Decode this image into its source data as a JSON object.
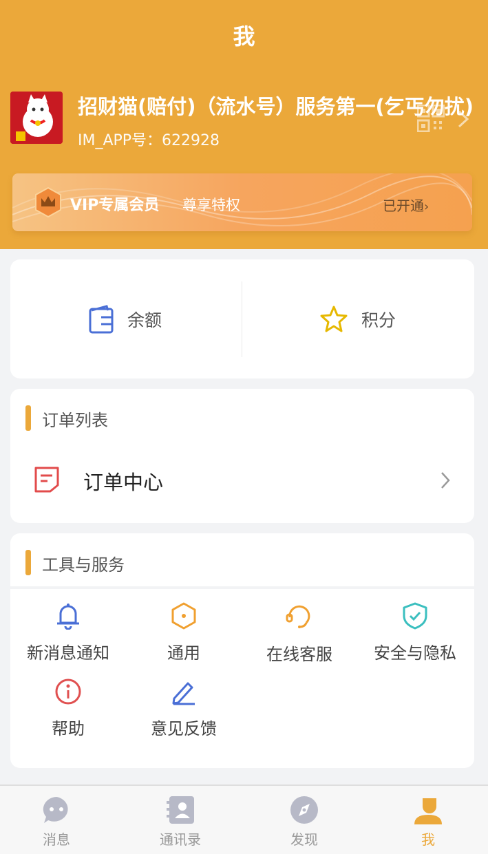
{
  "header": {
    "title": "我",
    "profile": {
      "name": "招财猫(赔付)（流水号）服务第一(乞丐勿扰)",
      "id_text": "IM_APP号：622928"
    },
    "vip": {
      "title": "VIP专属会员",
      "subtitle": "尊享特权",
      "status": "已开通"
    }
  },
  "wallet": {
    "balance_label": "余额",
    "points_label": "积分"
  },
  "orders": {
    "section_title": "订单列表",
    "center_label": "订单中心"
  },
  "tools": {
    "section_title": "工具与服务",
    "items": [
      {
        "label": "新消息通知",
        "icon": "bell-icon",
        "color": "#4a6fd6"
      },
      {
        "label": "通用",
        "icon": "hexagon-icon",
        "color": "#f0a030"
      },
      {
        "label": "在线客服",
        "icon": "headset-icon",
        "color": "#f0a030"
      },
      {
        "label": "安全与隐私",
        "icon": "shield-icon",
        "color": "#3bbfbf"
      },
      {
        "label": "帮助",
        "icon": "info-icon",
        "color": "#e05050"
      },
      {
        "label": "意见反馈",
        "icon": "pencil-icon",
        "color": "#4a6fd6"
      }
    ]
  },
  "tabbar": {
    "items": [
      {
        "label": "消息",
        "icon": "chat-icon"
      },
      {
        "label": "通讯录",
        "icon": "contacts-icon"
      },
      {
        "label": "发现",
        "icon": "compass-icon"
      },
      {
        "label": "我",
        "icon": "person-icon",
        "active": true
      }
    ]
  },
  "colors": {
    "accent": "#eba83a",
    "inactive_tab": "#999999"
  }
}
